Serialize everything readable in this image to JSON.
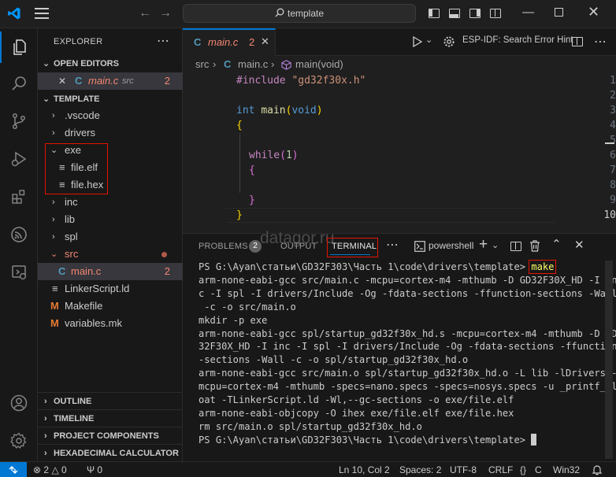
{
  "titlebar": {
    "search_text": "template"
  },
  "sidebar": {
    "title": "EXPLORER",
    "open_editors": {
      "header": "OPEN EDITORS",
      "items": [
        {
          "name": "main.c",
          "folder": "src",
          "badge": "2"
        }
      ]
    },
    "workspace": {
      "header": "TEMPLATE",
      "items": [
        {
          "name": ".vscode",
          "type": "folder-closed"
        },
        {
          "name": "drivers",
          "type": "folder-closed"
        },
        {
          "name": "exe",
          "type": "folder-open"
        },
        {
          "name": "file.elf",
          "type": "file"
        },
        {
          "name": "file.hex",
          "type": "file"
        },
        {
          "name": "inc",
          "type": "folder-closed"
        },
        {
          "name": "lib",
          "type": "folder-closed"
        },
        {
          "name": "spl",
          "type": "folder-closed"
        },
        {
          "name": "src",
          "type": "folder-open"
        },
        {
          "name": "main.c",
          "type": "c-file",
          "badge": "2"
        },
        {
          "name": "LinkerScript.ld",
          "type": "file"
        },
        {
          "name": "Makefile",
          "type": "m-file"
        },
        {
          "name": "variables.mk",
          "type": "m-file"
        }
      ]
    },
    "bottom_sections": [
      "OUTLINE",
      "TIMELINE",
      "PROJECT COMPONENTS",
      "HEXADECIMAL CALCULATOR"
    ]
  },
  "editor": {
    "tab": {
      "name": "main.c",
      "badge": "2"
    },
    "toolbar_label": "ESP-IDF: Search Error Hint",
    "breadcrumb": {
      "folder": "src",
      "file": "main.c",
      "symbol": "main(void)"
    },
    "line_numbers": [
      "1",
      "2",
      "3",
      "4",
      "5",
      "6",
      "7",
      "8",
      "9",
      "10"
    ],
    "code": {
      "include_kw": "#include",
      "include_str": "\"gd32f30x.h\"",
      "int_kw": "int",
      "main_fn": "main",
      "void_kw": "void",
      "open_brace": "{",
      "while_kw": "while",
      "while_arg": "1",
      "inner_open": "{",
      "inner_close": "}",
      "close_brace": "}"
    }
  },
  "panel": {
    "tabs": [
      "PROBLEMS",
      "OUTPUT",
      "TERMINAL"
    ],
    "problems_badge": "2",
    "shell": "powershell",
    "watermark": "datagor.ru",
    "prompt": "PS G:\\Ayan\\статьи\\GD32F303\\Часть 1\\code\\drivers\\template>",
    "command": "make",
    "output_lines": [
      "arm-none-eabi-gcc src/main.c -mcpu=cortex-m4 -mthumb -D GD32F30X_HD -I in",
      "c -I spl -I drivers/Include -Og -fdata-sections -ffunction-sections -Wall",
      " -c -o src/main.o",
      "mkdir -p exe",
      "arm-none-eabi-gcc spl/startup_gd32f30x_hd.s -mcpu=cortex-m4 -mthumb -D GD",
      "32F30X_HD -I inc -I spl -I drivers/Include -Og -fdata-sections -ffunction",
      "-sections -Wall -c -o spl/startup_gd32f30x_hd.o",
      "arm-none-eabi-gcc src/main.o spl/startup_gd32f30x_hd.o -L lib -lDrivers -",
      "mcpu=cortex-m4 -mthumb -specs=nano.specs -specs=nosys.specs -u _printf_fl",
      "oat -TLinkerScript.ld -Wl,--gc-sections -o exe/file.elf",
      "arm-none-eabi-objcopy -O ihex exe/file.elf exe/file.hex",
      "rm src/main.o spl/startup_gd32f30x_hd.o"
    ],
    "final_prompt": "PS G:\\Ayan\\статьи\\GD32F303\\Часть 1\\code\\drivers\\template>"
  },
  "statusbar": {
    "errors": "2",
    "warnings": "0",
    "ports": "0",
    "position": "Ln 10, Col 2",
    "spaces": "Spaces: 2",
    "encoding": "UTF-8",
    "eol": "CRLF",
    "language": "C",
    "platform": "Win32"
  },
  "colors": {
    "accent": "#0078d4",
    "highlight_box": "#e51400",
    "c_icon": "#519aba",
    "m_icon": "#e37933",
    "error_red": "#f14c4c",
    "modified_orange": "#e2c08d"
  }
}
